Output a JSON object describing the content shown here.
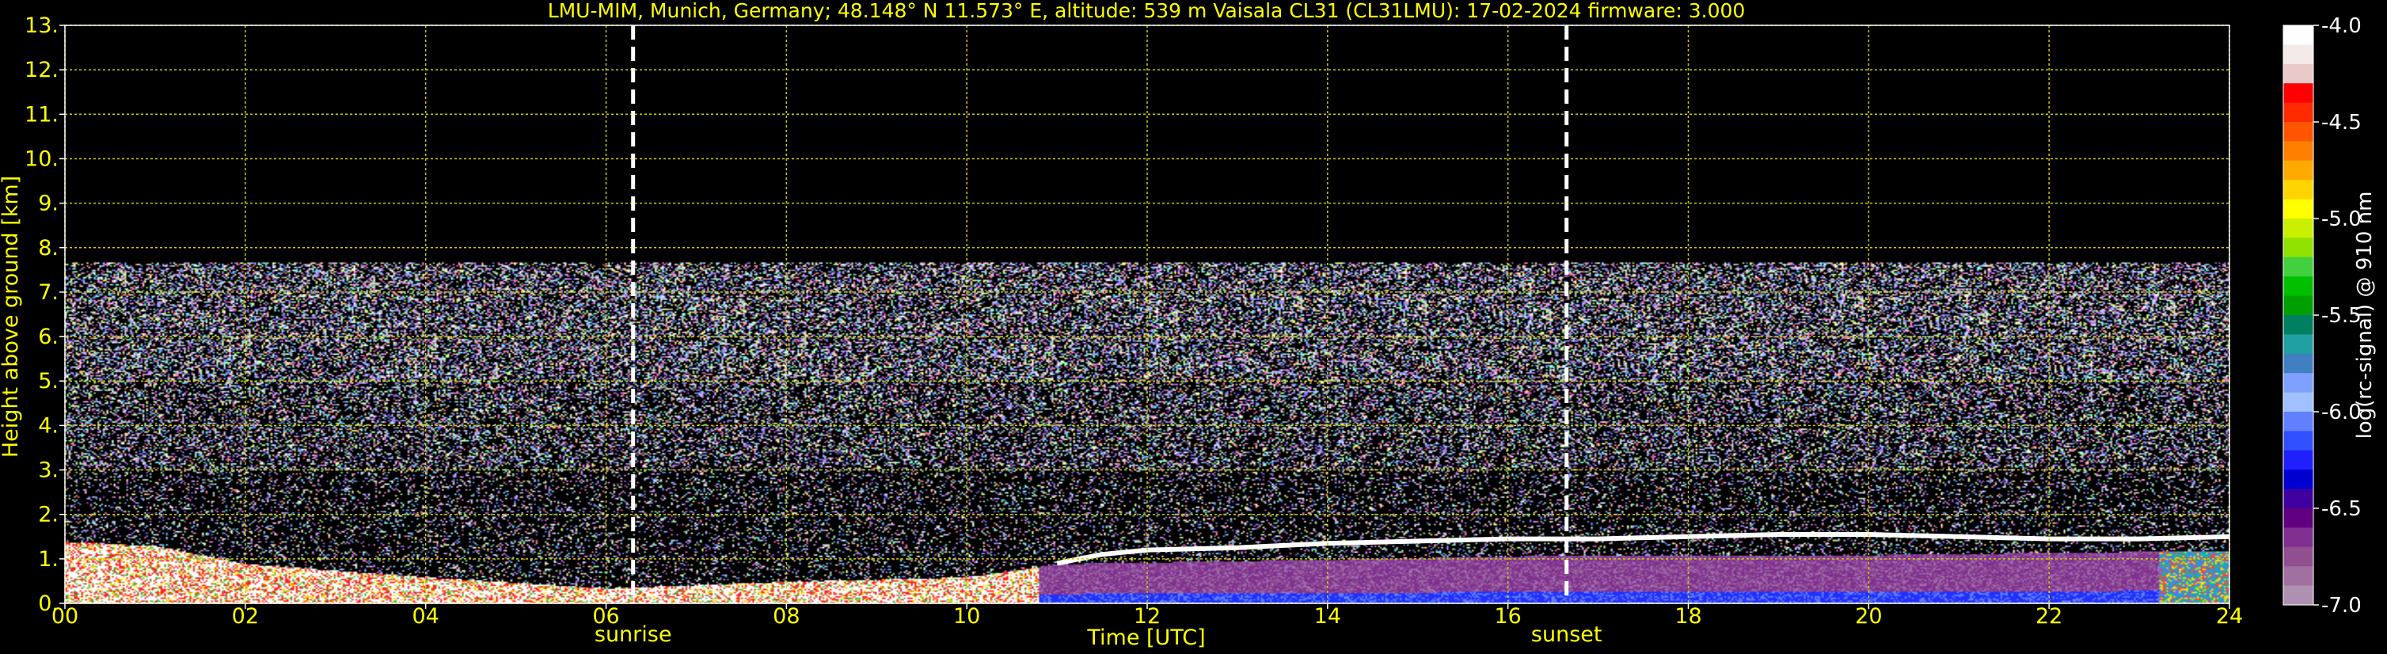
{
  "chart_data": {
    "type": "heatmap",
    "title": "LMU-MIM, Munich, Germany; 48.148° N 11.573° E, altitude: 539 m    Vaisala CL31 (CL31LMU): 17-02-2024    firmware: 3.000",
    "xlabel": "Time [UTC]",
    "ylabel": "Height above ground [km]",
    "xlim": [
      0,
      24
    ],
    "ylim": [
      0,
      13
    ],
    "xticks": [
      0,
      2,
      4,
      6,
      8,
      10,
      12,
      14,
      16,
      18,
      20,
      22,
      24
    ],
    "xtick_labels": [
      "00",
      "02",
      "04",
      "06",
      "08",
      "10",
      "12",
      "14",
      "16",
      "18",
      "20",
      "22",
      "24"
    ],
    "yticks": [
      0,
      1,
      2,
      3,
      4,
      5,
      6,
      7,
      8,
      9,
      10,
      11,
      12,
      13
    ],
    "ytick_labels": [
      "0.",
      "1.",
      "2.",
      "3.",
      "4.",
      "5.",
      "6.",
      "7.",
      "8.",
      "9.",
      "10.",
      "11.",
      "12.",
      "13."
    ],
    "grid": true,
    "grid_color": "#cccc00",
    "text_color": "#ffff00",
    "background": "#000000",
    "markers": [
      {
        "label": "sunrise",
        "x": 6.3
      },
      {
        "label": "sunset",
        "x": 16.65
      }
    ],
    "signal_max_height_km": 7.7,
    "colorbar": {
      "label": "log(rc-signal) @ 910 nm",
      "range": [
        -7.0,
        -4.0
      ],
      "ticks": [
        -4.0,
        -4.5,
        -5.0,
        -5.5,
        -6.0,
        -6.5,
        -7.0
      ],
      "tick_labels": [
        "-4.0",
        "-4.5",
        "-5.0",
        "-5.5",
        "-6.0",
        "-6.5",
        "-7.0"
      ],
      "colors": [
        "#ffffff",
        "#f4eaea",
        "#e8c8c8",
        "#ff0000",
        "#ff2a00",
        "#ff5500",
        "#ff8000",
        "#ffaa00",
        "#ffd400",
        "#ffff00",
        "#c8f000",
        "#90e000",
        "#40d040",
        "#00c000",
        "#00a000",
        "#008060",
        "#20a0a0",
        "#4080c0",
        "#80a0ff",
        "#a0c0ff",
        "#6080ff",
        "#3050ff",
        "#2020ff",
        "#0000d0",
        "#4000a0",
        "#600080",
        "#803090",
        "#905090",
        "#a070a0",
        "#b090b0"
      ]
    },
    "cloud_layer": [
      {
        "x": 11.0,
        "y": 0.9
      },
      {
        "x": 11.5,
        "y": 1.1
      },
      {
        "x": 12.0,
        "y": 1.2
      },
      {
        "x": 13.0,
        "y": 1.25
      },
      {
        "x": 14.0,
        "y": 1.35
      },
      {
        "x": 15.0,
        "y": 1.4
      },
      {
        "x": 16.0,
        "y": 1.45
      },
      {
        "x": 17.0,
        "y": 1.45
      },
      {
        "x": 18.0,
        "y": 1.5
      },
      {
        "x": 19.0,
        "y": 1.55
      },
      {
        "x": 20.0,
        "y": 1.55
      },
      {
        "x": 21.0,
        "y": 1.5
      },
      {
        "x": 22.0,
        "y": 1.45
      },
      {
        "x": 23.0,
        "y": 1.45
      },
      {
        "x": 24.0,
        "y": 1.5
      }
    ],
    "boundary_layer_top": [
      {
        "x": 0.0,
        "y": 1.4
      },
      {
        "x": 1.0,
        "y": 1.3
      },
      {
        "x": 2.0,
        "y": 0.9
      },
      {
        "x": 4.0,
        "y": 0.6
      },
      {
        "x": 6.0,
        "y": 0.35
      },
      {
        "x": 8.0,
        "y": 0.5
      },
      {
        "x": 10.0,
        "y": 0.6
      },
      {
        "x": 11.0,
        "y": 0.9
      },
      {
        "x": 14.0,
        "y": 1.0
      },
      {
        "x": 17.0,
        "y": 1.1
      },
      {
        "x": 20.0,
        "y": 1.1
      },
      {
        "x": 24.0,
        "y": 1.2
      }
    ]
  }
}
